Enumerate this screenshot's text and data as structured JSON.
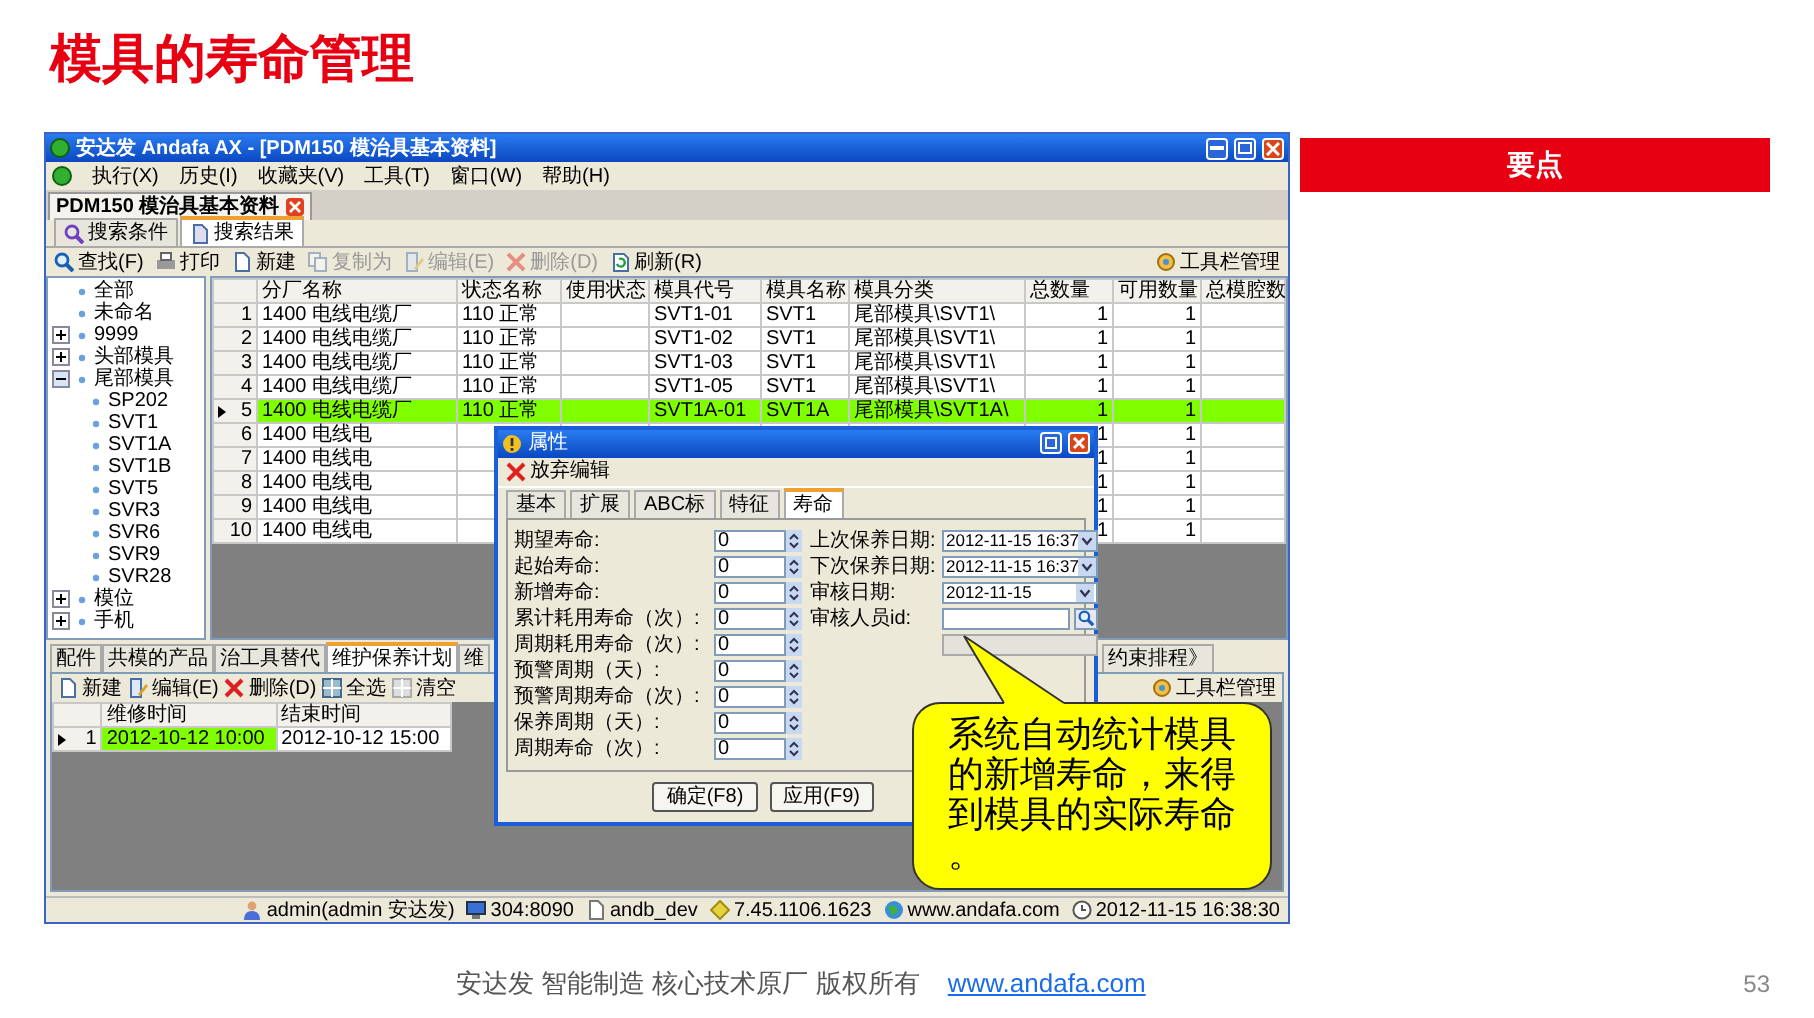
{
  "slide": {
    "title": "模具的寿命管理",
    "key_point": "要点",
    "footer_text": "安达发  智能制造 核心技术原厂  版权所有",
    "footer_link": "www.andafa.com",
    "page_number": "53"
  },
  "window": {
    "title": "安达发 Andafa AX - [PDM150 模治具基本资料]"
  },
  "menu": [
    "执行(X)",
    "历史(I)",
    "收藏夹(V)",
    "工具(T)",
    "窗口(W)",
    "帮助(H)"
  ],
  "document_tab": "PDM150 模治具基本资料",
  "search_tabs": [
    {
      "label": "搜索条件",
      "selected": false
    },
    {
      "label": "搜索结果",
      "selected": true
    }
  ],
  "toolbar": {
    "buttons": [
      {
        "label": "查找(F)",
        "kind": "search",
        "disabled": false
      },
      {
        "label": "打印",
        "kind": "print",
        "disabled": false
      },
      {
        "label": "新建",
        "kind": "new",
        "disabled": false
      },
      {
        "label": "复制为",
        "kind": "copy",
        "disabled": true
      },
      {
        "label": "编辑(E)",
        "kind": "edit",
        "disabled": true
      },
      {
        "label": "删除(D)",
        "kind": "delete",
        "disabled": true
      },
      {
        "label": "刷新(R)",
        "kind": "refresh",
        "disabled": false
      }
    ],
    "manage": "工具栏管理"
  },
  "tree": [
    {
      "label": "全部",
      "kind": "leaf"
    },
    {
      "label": "未命名",
      "kind": "leaf"
    },
    {
      "label": "9999",
      "kind": "group",
      "expanded": false
    },
    {
      "label": "头部模具",
      "kind": "group",
      "expanded": false
    },
    {
      "label": "尾部模具",
      "kind": "group",
      "expanded": true,
      "children": [
        {
          "label": "SP202"
        },
        {
          "label": "SVT1"
        },
        {
          "label": "SVT1A"
        },
        {
          "label": "SVT1B"
        },
        {
          "label": "SVT5"
        },
        {
          "label": "SVR3"
        },
        {
          "label": "SVR6"
        },
        {
          "label": "SVR9"
        },
        {
          "label": "SVR28"
        }
      ]
    },
    {
      "label": "模位",
      "kind": "group",
      "expanded": false
    },
    {
      "label": "手机",
      "kind": "group",
      "expanded": false
    }
  ],
  "grid": {
    "columns": [
      "分厂名称",
      "状态名称",
      "使用状态",
      "模具代号",
      "模具名称",
      "模具分类",
      "总数量",
      "可用数量",
      "总模腔数"
    ],
    "rows": [
      {
        "number": "1",
        "selected": false,
        "cells": [
          "1400 电线电缆厂",
          "110 正常",
          null,
          "SVT1-01",
          "SVT1",
          "尾部模具\\SVT1\\",
          "1",
          "1",
          null
        ]
      },
      {
        "number": "2",
        "selected": false,
        "cells": [
          "1400 电线电缆厂",
          "110 正常",
          null,
          "SVT1-02",
          "SVT1",
          "尾部模具\\SVT1\\",
          "1",
          "1",
          null
        ]
      },
      {
        "number": "3",
        "selected": false,
        "cells": [
          "1400 电线电缆厂",
          "110 正常",
          null,
          "SVT1-03",
          "SVT1",
          "尾部模具\\SVT1\\",
          "1",
          "1",
          null
        ]
      },
      {
        "number": "4",
        "selected": false,
        "cells": [
          "1400 电线电缆厂",
          "110 正常",
          null,
          "SVT1-05",
          "SVT1",
          "尾部模具\\SVT1\\",
          "1",
          "1",
          null
        ]
      },
      {
        "number": "5",
        "selected": true,
        "cells": [
          "1400 电线电缆厂",
          "110 正常",
          null,
          "SVT1A-01",
          "SVT1A",
          "尾部模具\\SVT1A\\",
          "1",
          "1",
          null
        ]
      },
      {
        "number": "6",
        "selected": false,
        "cells": [
          "1400 电线电",
          null,
          null,
          null,
          null,
          null,
          "1",
          "1",
          null
        ]
      },
      {
        "number": "7",
        "selected": false,
        "cells": [
          "1400 电线电",
          null,
          null,
          null,
          null,
          null,
          "1",
          "1",
          null
        ]
      },
      {
        "number": "8",
        "selected": false,
        "cells": [
          "1400 电线电",
          null,
          null,
          null,
          null,
          null,
          "1",
          "1",
          null
        ]
      },
      {
        "number": "9",
        "selected": false,
        "cells": [
          "1400 电线电",
          null,
          null,
          null,
          null,
          null,
          "1",
          "1",
          null
        ]
      },
      {
        "number": "10",
        "selected": false,
        "cells": [
          "1400 电线电",
          null,
          null,
          null,
          null,
          null,
          "1",
          "1",
          null
        ]
      }
    ]
  },
  "detail_tabs": [
    {
      "label": "配件",
      "selected": false
    },
    {
      "label": "共模的产品",
      "selected": false
    },
    {
      "label": "治工具替代",
      "selected": false
    },
    {
      "label": "维护保养计划",
      "selected": true
    },
    {
      "label": "维",
      "selected": false
    },
    {
      "label": "约束排程》",
      "selected": false
    }
  ],
  "detail_toolbar": {
    "buttons": [
      {
        "label": "新建",
        "kind": "new",
        "disabled": false
      },
      {
        "label": "编辑(E)",
        "kind": "edit",
        "disabled": false
      },
      {
        "label": "删除(D)",
        "kind": "delete",
        "disabled": false
      },
      {
        "label": "全选",
        "kind": "select_all",
        "disabled": false
      },
      {
        "label": "清空",
        "kind": "clear",
        "disabled": false
      }
    ],
    "manage": "工具栏管理"
  },
  "detail_grid": {
    "columns": [
      "维修时间",
      "结束时间"
    ],
    "rows": [
      {
        "number": "1",
        "selected": true,
        "cells": [
          "2012-10-12 10:00",
          "2012-10-12 15:00"
        ]
      }
    ]
  },
  "status_bar": [
    {
      "kind": "user",
      "text": "admin(admin 安达发)"
    },
    {
      "kind": "server",
      "text": "304:8090"
    },
    {
      "kind": "database",
      "text": "andb_dev"
    },
    {
      "kind": "version",
      "text": "7.45.1106.1623"
    },
    {
      "kind": "web",
      "text": "www.andafa.com"
    },
    {
      "kind": "time",
      "text": "2012-11-15 16:38:30"
    }
  ],
  "dialog": {
    "title": "属性",
    "action": "放弃编辑",
    "tabs": [
      {
        "label": "基本",
        "selected": false
      },
      {
        "label": "扩展",
        "selected": false
      },
      {
        "label": "ABC标",
        "selected": false
      },
      {
        "label": "特征",
        "selected": false
      },
      {
        "label": "寿命",
        "selected": true
      }
    ],
    "left_fields": [
      {
        "label": "期望寿命:",
        "value": "0"
      },
      {
        "label": "起始寿命:",
        "value": "0"
      },
      {
        "label": "新增寿命:",
        "value": "0"
      },
      {
        "label": "累计耗用寿命（次）:",
        "value": "0"
      },
      {
        "label": "周期耗用寿命（次）:",
        "value": "0"
      },
      {
        "label": "预警周期（天）:",
        "value": "0"
      },
      {
        "label": "预警周期寿命（次）:",
        "value": "0"
      },
      {
        "label": "保养周期（天）:",
        "value": "0"
      },
      {
        "label": "周期寿命（次）:",
        "value": "0"
      }
    ],
    "right_fields": [
      {
        "kind": "date",
        "label": "上次保养日期:",
        "value": "2012-11-15 16:37"
      },
      {
        "kind": "date",
        "label": "下次保养日期:",
        "value": "2012-11-15 16:37"
      },
      {
        "kind": "date",
        "label": "审核日期:",
        "value": "2012-11-15"
      },
      {
        "kind": "lookup",
        "label": "审核人员id:"
      },
      {
        "kind": "readonly"
      }
    ],
    "buttons": [
      "确定(F8)",
      "应用(F9)"
    ]
  },
  "callout": {
    "text": "系统自动统计模具的新增寿命，来得到模具的实际寿命。"
  }
}
